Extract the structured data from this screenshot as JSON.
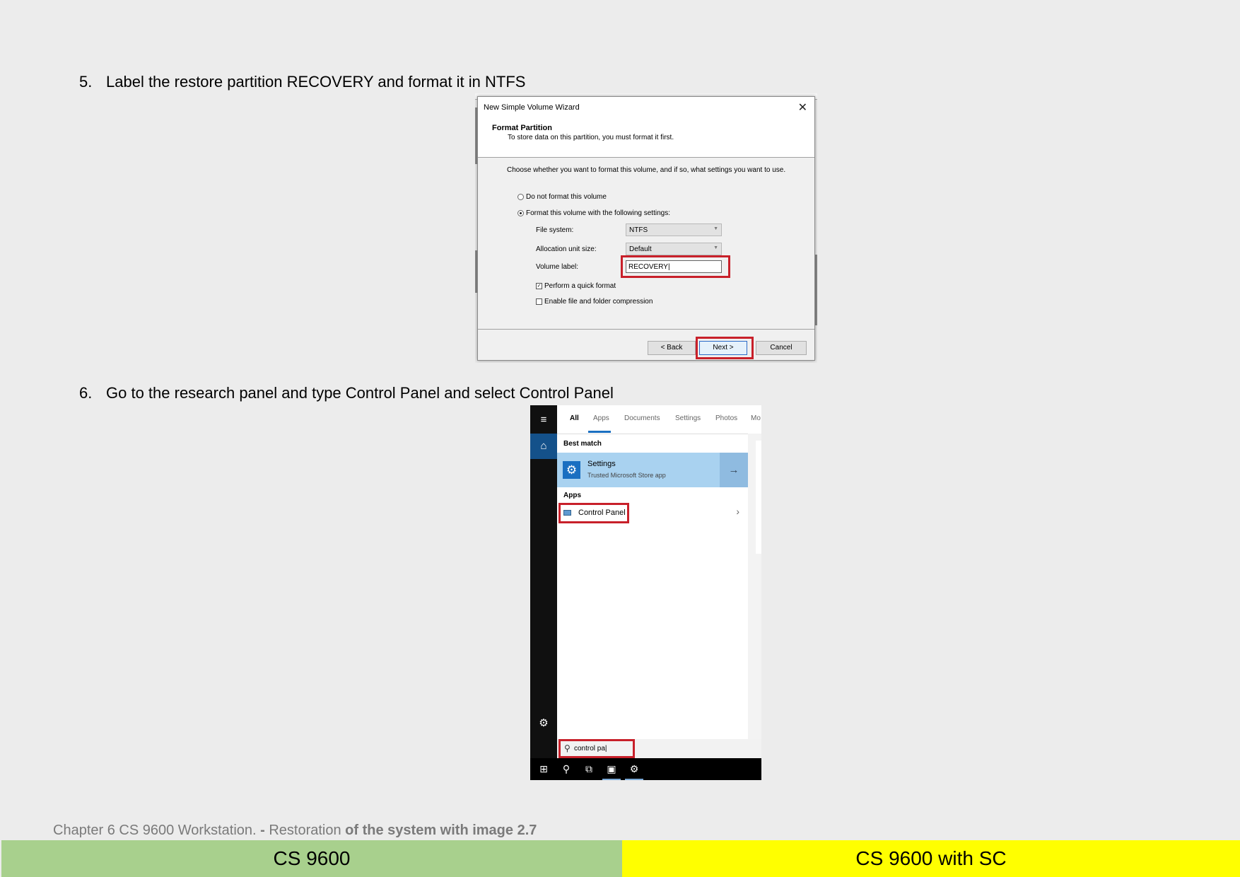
{
  "steps": {
    "step5": {
      "number": "5.",
      "text": "Label the restore partition RECOVERY and format it in NTFS"
    },
    "step6": {
      "number": "6.",
      "text": "Go to the research panel and type Control Panel and select Control Panel"
    }
  },
  "wizard": {
    "title": "New Simple Volume Wizard",
    "header_title": "Format Partition",
    "header_subtitle": "To store data on this partition, you must format it first.",
    "instruction": "Choose whether you want to format this volume, and if so, what settings you want to use.",
    "radio_no_format": "Do not format this volume",
    "radio_format": "Format this volume with the following settings:",
    "file_system_label": "File system:",
    "file_system_value": "NTFS",
    "allocation_label": "Allocation unit size:",
    "allocation_value": "Default",
    "volume_label_label": "Volume label:",
    "volume_label_value": "RECOVERY",
    "quick_format": "Perform a quick format",
    "compression": "Enable file and folder compression",
    "back_button": "< Back",
    "next_button": "Next >",
    "cancel_button": "Cancel"
  },
  "search_panel": {
    "tabs": [
      "All",
      "Apps",
      "Documents",
      "Settings",
      "Photos",
      "Mo"
    ],
    "best_match_title": "Best match",
    "best_match_name": "Settings",
    "best_match_sub": "Trusted Microsoft Store app",
    "apps_title": "Apps",
    "control_panel_label": "Control Panel",
    "search_text": "control pa"
  },
  "footer": {
    "caption_chapter": "Chapter 6 CS 9600 Workstation.",
    "caption_dash": " - ",
    "caption_restoration": "Restoration",
    "caption_rest": " of the system with image 2.7",
    "left_label": "CS 9600",
    "right_label": "CS 9600 with SC"
  },
  "colors": {
    "page_background": "#ececec",
    "footer_left": "#a8d08d",
    "footer_right": "#ffff00",
    "highlight_red": "#c8202a",
    "accent_blue": "#1a6fc1"
  }
}
